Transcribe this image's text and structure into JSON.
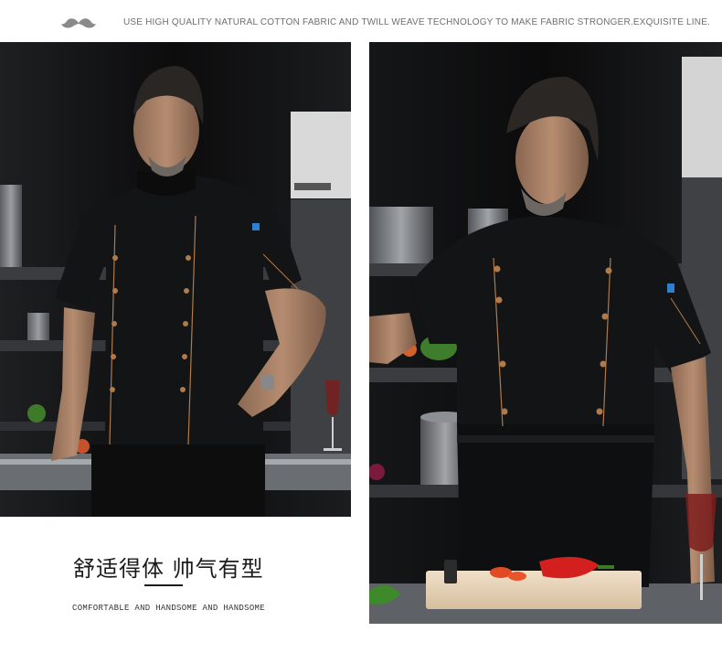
{
  "header": {
    "tagline": "USE HIGH QUALITY NATURAL COTTON FABRIC AND TWILL WEAVE TECHNOLOGY TO MAKE FABRIC STRONGER.EXQUISITE LINE.",
    "icon": "mustache-icon"
  },
  "photos": {
    "left": {
      "subject": "chef-in-black-double-breasted-short-sleeve-jacket"
    },
    "right": {
      "subject": "chef-in-black-jacket-and-apron-at-cutting-board"
    }
  },
  "caption": {
    "headline": "舒适得体  帅气有型",
    "subline": "COMFORTABLE AND HANDSOME AND HANDSOME"
  },
  "colors": {
    "accent_trim": "#b07a4a",
    "badge": "#2f7fd1",
    "jacket": "#141517",
    "background": "#ffffff"
  }
}
